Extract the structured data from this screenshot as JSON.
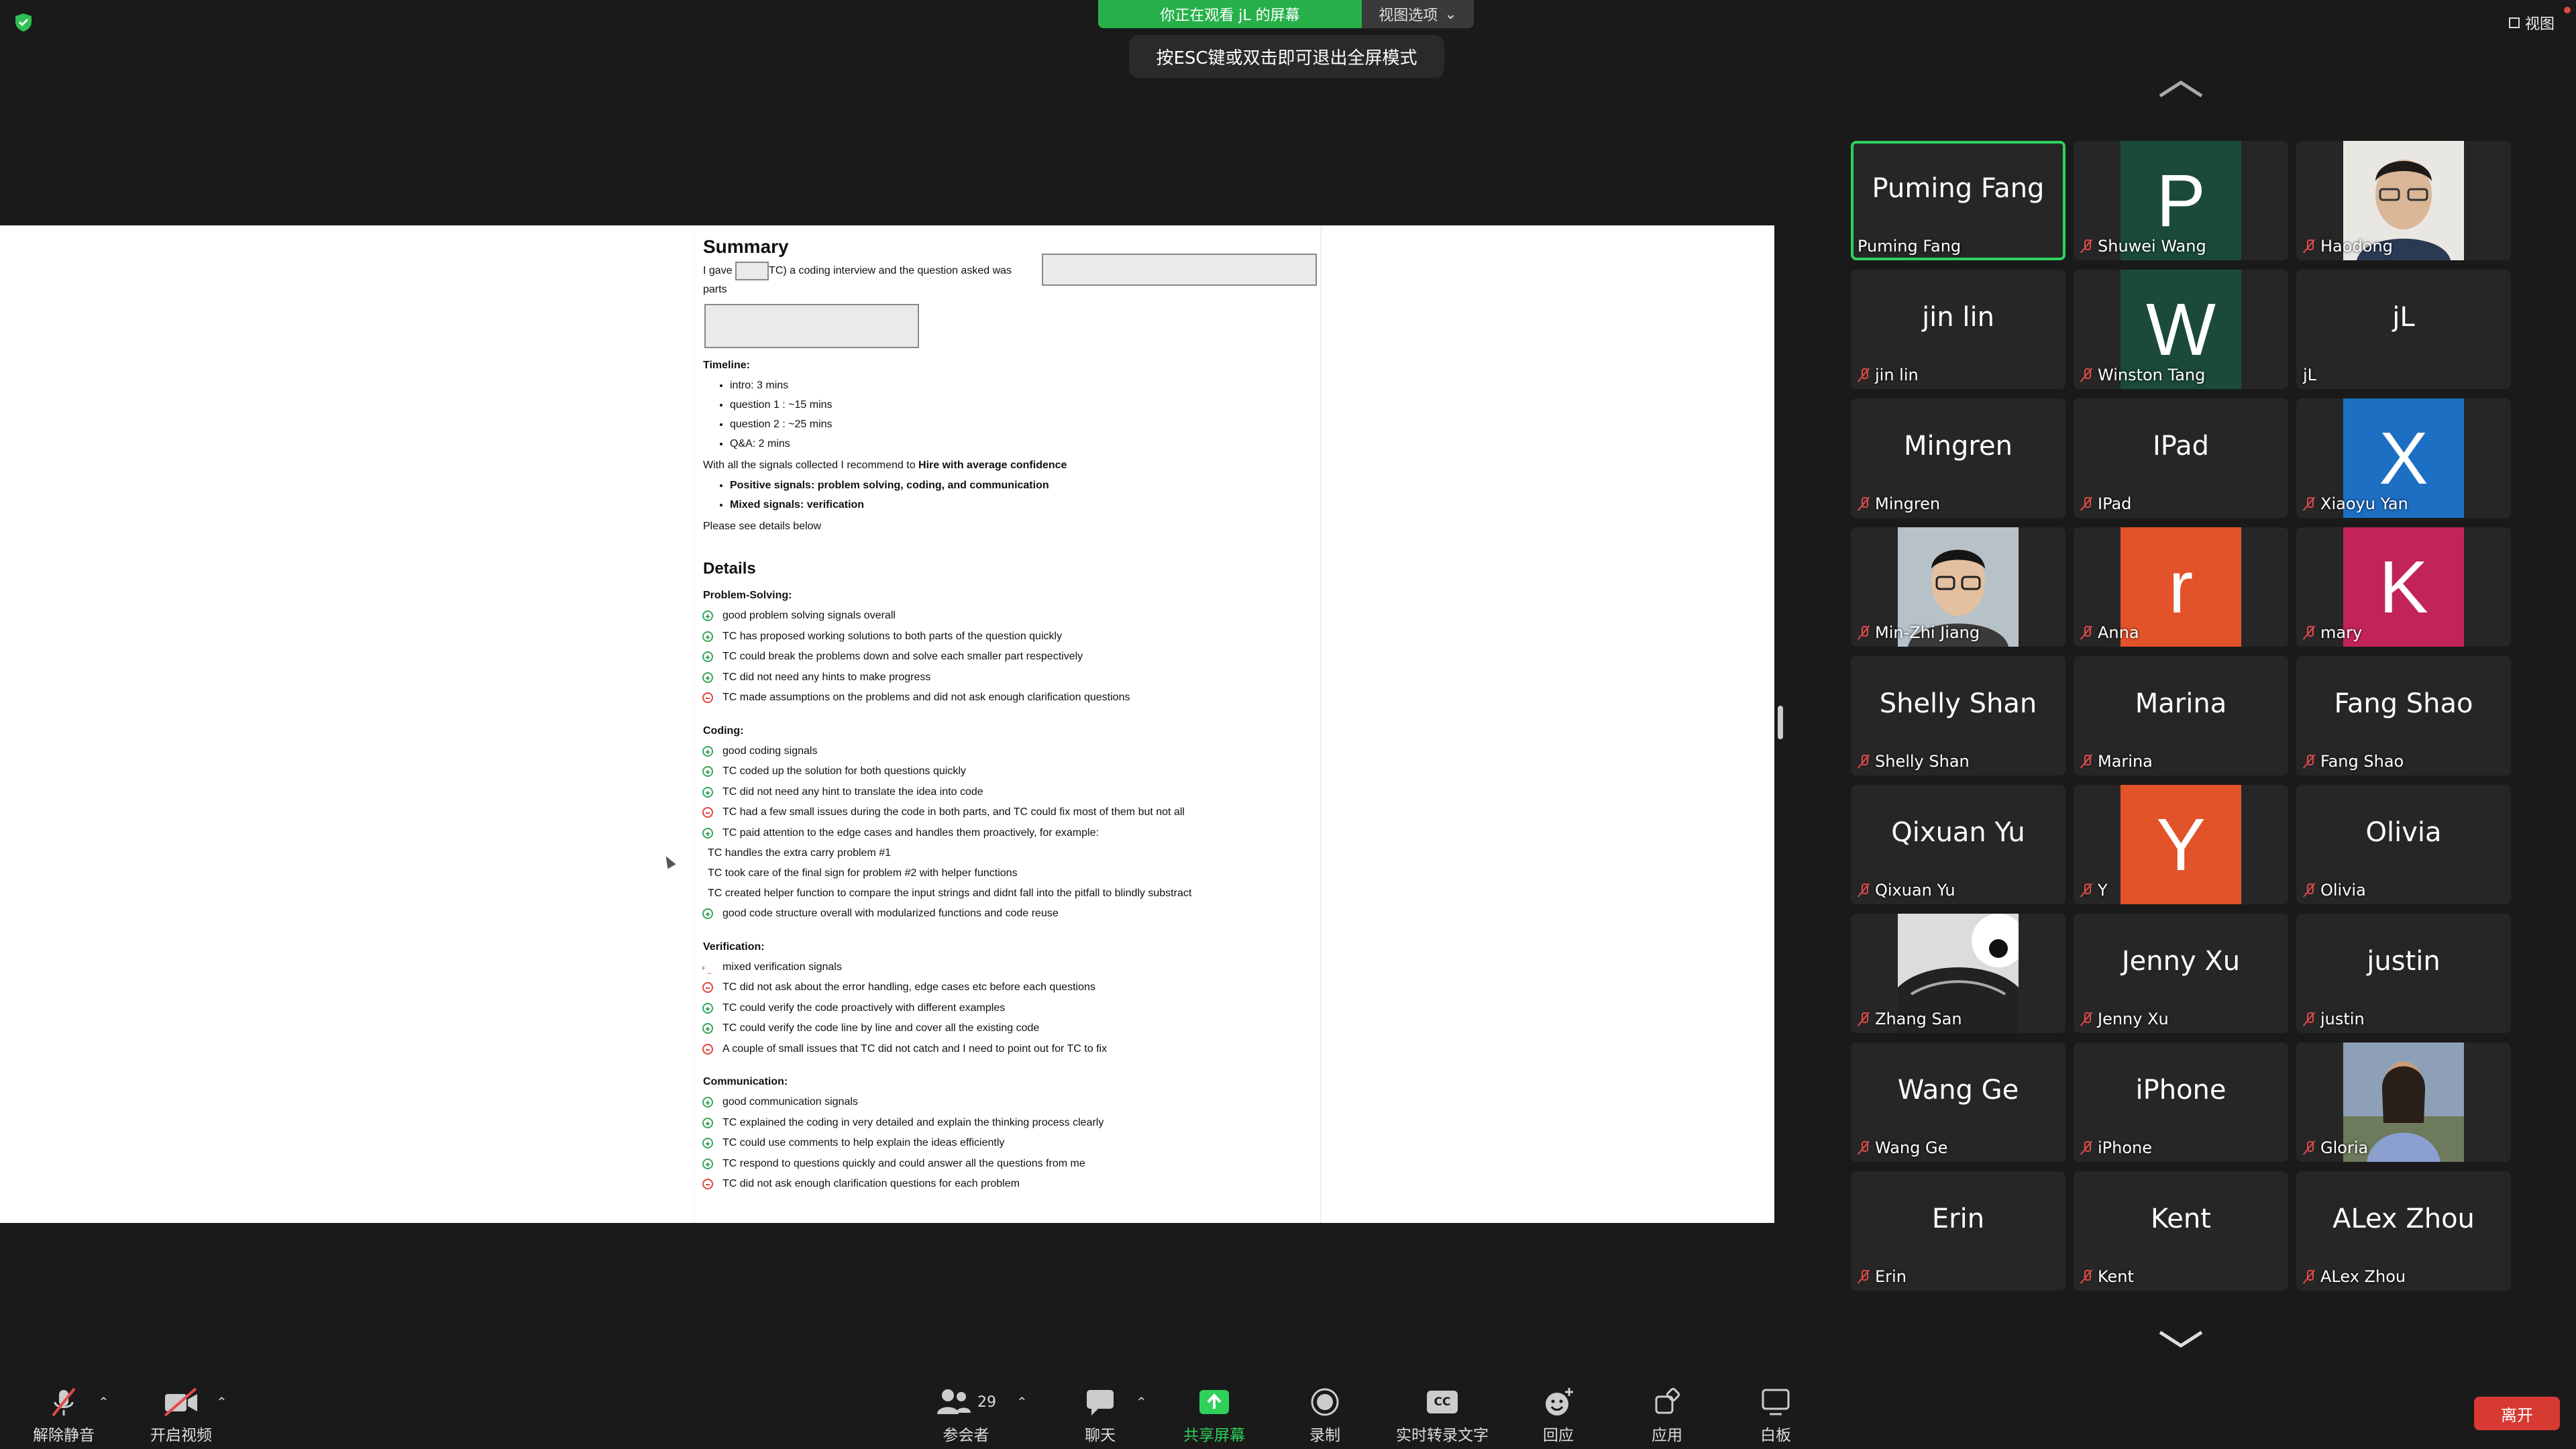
{
  "banner": {
    "viewing": "你正在观看 jL 的屏幕",
    "options": "视图选项",
    "esc_hint": "按ESC键或双击即可退出全屏模式",
    "view_label": "视图"
  },
  "doc": {
    "summary_title": "Summary",
    "intro_a": "I gave",
    "intro_b": "TC) a coding interview and the question asked was",
    "intro_c": "parts",
    "timeline_label": "Timeline:",
    "timeline": [
      "intro: 3 mins",
      "question 1 : ~15 mins",
      "question 2 : ~25 mins",
      "Q&A: 2 mins"
    ],
    "recommend_a": "With all the signals collected I recommend to ",
    "recommend_b": "Hire with average confidence",
    "signals": [
      "Positive signals: problem solving, coding, and communication",
      "Mixed signals: verification"
    ],
    "see_below": "Please see details below",
    "details_title": "Details",
    "sections": [
      {
        "title": "Problem-Solving:",
        "items": [
          {
            "t": "plus",
            "text": " good problem solving signals overall"
          },
          {
            "t": "plus",
            "text": "TC has proposed working solutions to both parts of the question quickly"
          },
          {
            "t": "plus",
            "text": "TC could break the problems down and solve each smaller part respectively"
          },
          {
            "t": "plus",
            "text": "TC did not need any hints to make progress"
          },
          {
            "t": "minus",
            "text": "TC made assumptions on the problems and did not ask enough clarification questions"
          }
        ]
      },
      {
        "title": "Coding:",
        "items": [
          {
            "t": "plus",
            "text": "good coding signals"
          },
          {
            "t": "plus",
            "text": "TC coded up the solution for both questions quickly"
          },
          {
            "t": "plus",
            "text": "TC did not need any hint to translate the idea into code"
          },
          {
            "t": "minus",
            "text": "TC had a few small issues during the code in both parts, and TC could fix most of them but not all"
          },
          {
            "t": "plus",
            "text": "TC paid attention to the edge cases and handles them proactively, for example:"
          },
          {
            "t": "none",
            "text": "TC handles the extra carry problem #1"
          },
          {
            "t": "none",
            "text": "TC took care of the final sign for problem #2 with helper functions"
          },
          {
            "t": "none",
            "text": "TC created helper function to compare the input strings and didnt fall into the pitfall to blindly substract"
          },
          {
            "t": "plus",
            "text": "good code structure overall with modularized functions and code reuse"
          }
        ]
      },
      {
        "title": "Verification:",
        "items": [
          {
            "t": "mixed",
            "text": "mixed verification signals"
          },
          {
            "t": "minus",
            "text": "TC did not ask about the error handling, edge cases etc before each questions"
          },
          {
            "t": "plus",
            "text": "TC could verify the code proactively with different examples"
          },
          {
            "t": "plus",
            "text": "TC could verify the code line by line and cover all the existing code"
          },
          {
            "t": "minus",
            "text": "A couple of small issues that TC did not catch and I need to point out for TC to fix"
          }
        ]
      },
      {
        "title": "Communication:",
        "items": [
          {
            "t": "plus",
            "text": "good  communication signals"
          },
          {
            "t": "plus",
            "text": "TC explained the coding in very detailed and explain the thinking process clearly"
          },
          {
            "t": "plus",
            "text": "TC could use comments to help explain the ideas efficiently"
          },
          {
            "t": "plus",
            "text": "TC respond to questions quickly and could answer all the questions from me"
          },
          {
            "t": "minus",
            "text": "TC did not ask enough clarification questions for each problem"
          }
        ]
      }
    ]
  },
  "participants": [
    {
      "display": "Puming Fang",
      "name": "Puming Fang",
      "kind": "text",
      "active": true,
      "muted": false
    },
    {
      "display": "P",
      "name": "Shuwei Wang",
      "kind": "avatar",
      "color": "#1b4a3c",
      "muted": true
    },
    {
      "display": "",
      "name": "Haodong",
      "kind": "photo",
      "photo": "man",
      "muted": true
    },
    {
      "display": "jin lin",
      "name": "jin lin",
      "kind": "text",
      "muted": true
    },
    {
      "display": "W",
      "name": "Winston Tang",
      "kind": "avatar",
      "color": "#1b4a3c",
      "muted": true
    },
    {
      "display": "jL",
      "name": "jL",
      "kind": "text",
      "muted": false
    },
    {
      "display": "Mingren",
      "name": "Mingren",
      "kind": "text",
      "muted": true
    },
    {
      "display": "IPad",
      "name": "IPad",
      "kind": "text",
      "muted": true
    },
    {
      "display": "X",
      "name": "Xiaoyu Yan",
      "kind": "avatar",
      "color": "#1d6fc4",
      "muted": true
    },
    {
      "display": "",
      "name": "Min-Zhi Jiang",
      "kind": "photo",
      "photo": "glasses",
      "muted": true
    },
    {
      "display": "r",
      "name": "Anna",
      "kind": "avatar",
      "color": "#e3532a",
      "muted": true
    },
    {
      "display": "K",
      "name": "mary",
      "kind": "avatar",
      "color": "#c2245a",
      "muted": true
    },
    {
      "display": "Shelly Shan",
      "name": "Shelly Shan",
      "kind": "text",
      "muted": true
    },
    {
      "display": "Marina",
      "name": "Marina",
      "kind": "text",
      "muted": true
    },
    {
      "display": "Fang Shao",
      "name": "Fang Shao",
      "kind": "text",
      "muted": true
    },
    {
      "display": "Qixuan Yu",
      "name": "Qixuan Yu",
      "kind": "text",
      "muted": true
    },
    {
      "display": "Y",
      "name": "Y",
      "kind": "avatar",
      "color": "#e3532a",
      "muted": true
    },
    {
      "display": "Olivia",
      "name": "Olivia",
      "kind": "text",
      "muted": true
    },
    {
      "display": "",
      "name": "Zhang San",
      "kind": "photo",
      "photo": "car",
      "muted": true
    },
    {
      "display": "Jenny Xu",
      "name": "Jenny Xu",
      "kind": "text",
      "muted": true
    },
    {
      "display": "justin",
      "name": "justin",
      "kind": "text",
      "muted": true
    },
    {
      "display": "Wang Ge",
      "name": "Wang Ge",
      "kind": "text",
      "muted": true
    },
    {
      "display": "iPhone",
      "name": "iPhone",
      "kind": "text",
      "muted": true
    },
    {
      "display": "",
      "name": "Gloria",
      "kind": "photo",
      "photo": "woman",
      "muted": true
    },
    {
      "display": "Erin",
      "name": "Erin",
      "kind": "text",
      "muted": true
    },
    {
      "display": "Kent",
      "name": "Kent",
      "kind": "text",
      "muted": true
    },
    {
      "display": "ALex Zhou",
      "name": "ALex Zhou",
      "kind": "text",
      "muted": true
    }
  ],
  "toolbar": {
    "unmute": "解除静音",
    "start_video": "开启视频",
    "participants": "参会者",
    "participants_count": "29",
    "chat": "聊天",
    "share": "共享屏幕",
    "record": "录制",
    "captions": "实时转录文字",
    "cc": "CC",
    "reactions": "回应",
    "apps": "应用",
    "whiteboard": "白板",
    "leave": "离开",
    "share_color": "#2fd15a",
    "leave_color": "#d63a33"
  }
}
